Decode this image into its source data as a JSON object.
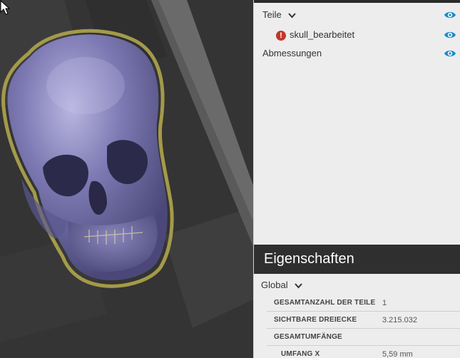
{
  "tree": {
    "parts_label": "Teile",
    "part_name": "skull_bearbeitet",
    "dimensions_label": "Abmessungen"
  },
  "properties": {
    "header": "Eigenschaften",
    "global_label": "Global",
    "rows": [
      {
        "key": "GESAMTANZAHL DER TEILE",
        "value": "1"
      },
      {
        "key": "SICHTBARE DREIECKE",
        "value": "3.215.032"
      },
      {
        "key": "GESAMTUMFÄNGE",
        "value": ""
      },
      {
        "key": "UMFANG X",
        "value": "5,59 mm"
      }
    ]
  },
  "icons": {
    "visibility": "eye-icon",
    "error": "error-icon",
    "expand": "chevron-down-icon",
    "cursor": "mouse-cursor-icon"
  },
  "colors": {
    "model": "#6e6a9e",
    "selection_outline": "#a39a4a",
    "eye": "#1a8ac9",
    "error": "#c0392b",
    "panel_header": "#2f2f2f"
  }
}
